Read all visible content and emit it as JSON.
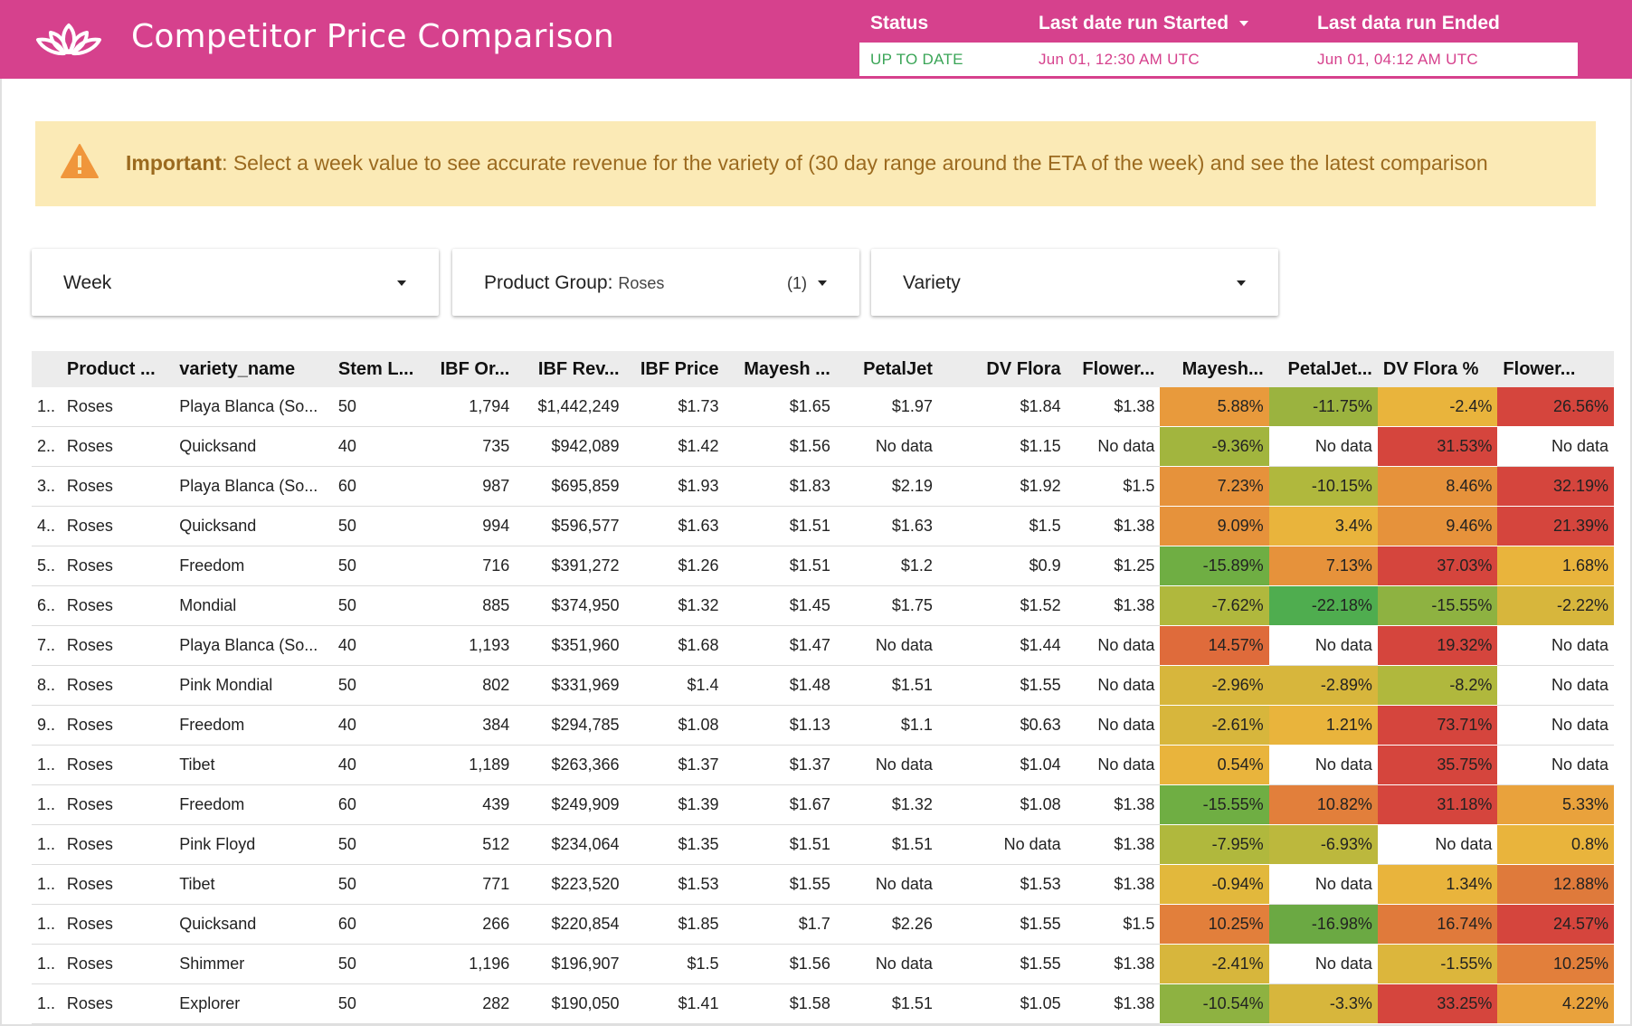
{
  "app": {
    "title": "Competitor Price Comparison"
  },
  "status": {
    "headers": {
      "status": "Status",
      "started": "Last date run Started",
      "ended": "Last data run Ended"
    },
    "status_value": "UP TO DATE",
    "started_value": "Jun 01, 12:30 AM UTC",
    "ended_value": "Jun 01, 04:12 AM UTC",
    "colors": {
      "status": "#3aa557",
      "dates": "#d6418d"
    }
  },
  "alert": {
    "icon": "warning-icon",
    "bold": "Important",
    "text": ": Select a week value to see accurate revenue for the variety of (30 day range around the ETA of the week) and see the latest comparison"
  },
  "filters": {
    "week": {
      "label": "Week"
    },
    "product_group": {
      "label": "Product Group:",
      "value": "Roses",
      "count": "(1)"
    },
    "variety": {
      "label": "Variety"
    }
  },
  "colors": {
    "brand": "#d6418d",
    "alert_bg": "#fbeab6",
    "alert_text": "#9b6a1f",
    "alert_icon": "#f0963b",
    "header_bg": "#ececec"
  },
  "table": {
    "columns": [
      "",
      "Product ...",
      "variety_name",
      "Stem L...",
      "IBF Or...",
      "IBF Rev...",
      "IBF Price",
      "Mayesh ...",
      "PetalJet",
      "DV Flora",
      "Flower...",
      "Mayesh...",
      "PetalJet...",
      "DV Flora %",
      "Flower..."
    ],
    "rows": [
      [
        "1..",
        "Roses",
        "Playa Blanca (So...",
        "50",
        "1,794",
        "$1,442,249",
        "$1.73",
        "$1.65",
        "$1.97",
        "$1.84",
        "$1.38",
        "5.88%",
        "-11.75%",
        "-2.4%",
        "26.56%"
      ],
      [
        "2..",
        "Roses",
        "Quicksand",
        "40",
        "735",
        "$942,089",
        "$1.42",
        "$1.56",
        "No data",
        "$1.15",
        "No data",
        "-9.36%",
        "No data",
        "31.53%",
        "No data"
      ],
      [
        "3..",
        "Roses",
        "Playa Blanca (So...",
        "60",
        "987",
        "$695,859",
        "$1.93",
        "$1.83",
        "$2.19",
        "$1.92",
        "$1.5",
        "7.23%",
        "-10.15%",
        "8.46%",
        "32.19%"
      ],
      [
        "4..",
        "Roses",
        "Quicksand",
        "50",
        "994",
        "$596,577",
        "$1.63",
        "$1.51",
        "$1.63",
        "$1.5",
        "$1.38",
        "9.09%",
        "3.4%",
        "9.46%",
        "21.39%"
      ],
      [
        "5..",
        "Roses",
        "Freedom",
        "50",
        "716",
        "$391,272",
        "$1.26",
        "$1.51",
        "$1.2",
        "$0.9",
        "$1.25",
        "-15.89%",
        "7.13%",
        "37.03%",
        "1.68%"
      ],
      [
        "6..",
        "Roses",
        "Mondial",
        "50",
        "885",
        "$374,950",
        "$1.32",
        "$1.45",
        "$1.75",
        "$1.52",
        "$1.38",
        "-7.62%",
        "-22.18%",
        "-15.55%",
        "-2.22%"
      ],
      [
        "7..",
        "Roses",
        "Playa Blanca (So...",
        "40",
        "1,193",
        "$351,960",
        "$1.68",
        "$1.47",
        "No data",
        "$1.44",
        "No data",
        "14.57%",
        "No data",
        "19.32%",
        "No data"
      ],
      [
        "8..",
        "Roses",
        "Pink Mondial",
        "50",
        "802",
        "$331,969",
        "$1.4",
        "$1.48",
        "$1.51",
        "$1.55",
        "No data",
        "-2.96%",
        "-2.89%",
        "-8.2%",
        "No data"
      ],
      [
        "9..",
        "Roses",
        "Freedom",
        "40",
        "384",
        "$294,785",
        "$1.08",
        "$1.13",
        "$1.1",
        "$0.63",
        "No data",
        "-2.61%",
        "1.21%",
        "73.71%",
        "No data"
      ],
      [
        "1..",
        "Roses",
        "Tibet",
        "40",
        "1,189",
        "$263,366",
        "$1.37",
        "$1.37",
        "No data",
        "$1.04",
        "No data",
        "0.54%",
        "No data",
        "35.75%",
        "No data"
      ],
      [
        "1..",
        "Roses",
        "Freedom",
        "60",
        "439",
        "$249,909",
        "$1.39",
        "$1.67",
        "$1.32",
        "$1.08",
        "$1.38",
        "-15.55%",
        "10.82%",
        "31.18%",
        "5.33%"
      ],
      [
        "1..",
        "Roses",
        "Pink Floyd",
        "50",
        "512",
        "$234,064",
        "$1.35",
        "$1.51",
        "$1.51",
        "No data",
        "$1.38",
        "-7.95%",
        "-6.93%",
        "No data",
        "0.8%"
      ],
      [
        "1..",
        "Roses",
        "Tibet",
        "50",
        "771",
        "$223,520",
        "$1.53",
        "$1.55",
        "No data",
        "$1.53",
        "$1.38",
        "-0.94%",
        "No data",
        "1.34%",
        "12.88%"
      ],
      [
        "1..",
        "Roses",
        "Quicksand",
        "60",
        "266",
        "$220,854",
        "$1.85",
        "$1.7",
        "$2.26",
        "$1.55",
        "$1.5",
        "10.25%",
        "-16.98%",
        "16.74%",
        "24.57%"
      ],
      [
        "1..",
        "Roses",
        "Shimmer",
        "50",
        "1,196",
        "$196,907",
        "$1.5",
        "$1.56",
        "No data",
        "$1.55",
        "$1.38",
        "-2.41%",
        "No data",
        "-1.55%",
        "10.25%"
      ],
      [
        "1..",
        "Roses",
        "Explorer",
        "50",
        "282",
        "$190,050",
        "$1.41",
        "$1.58",
        "$1.51",
        "$1.05",
        "$1.38",
        "-10.54%",
        "-3.3%",
        "33.25%",
        "4.22%"
      ]
    ],
    "cell_colors": [
      [
        "#e89a3c",
        "#9bb33f",
        "#e9b43c",
        "#d5453d"
      ],
      [
        "#a2b53e",
        "#ffffff",
        "#d5453d",
        "#ffffff"
      ],
      [
        "#e6923b",
        "#b0b83d",
        "#e6923b",
        "#d5453d"
      ],
      [
        "#e6923b",
        "#e9b43c",
        "#e6923b",
        "#d5453d"
      ],
      [
        "#6fae43",
        "#e6923b",
        "#d5453d",
        "#e9b43c"
      ],
      [
        "#b0b83d",
        "#4fad4f",
        "#8eb241",
        "#d7b63c"
      ],
      [
        "#df6b3b",
        "#ffffff",
        "#d5453d",
        "#ffffff"
      ],
      [
        "#d7b63c",
        "#d7b63c",
        "#b0b83d",
        "#ffffff"
      ],
      [
        "#d7b63c",
        "#e9b43c",
        "#d5453d",
        "#ffffff"
      ],
      [
        "#e9b43c",
        "#ffffff",
        "#d5453d",
        "#ffffff"
      ],
      [
        "#6fae43",
        "#e27f3b",
        "#d5453d",
        "#e9a23c"
      ],
      [
        "#b0b83d",
        "#bcb83d",
        "#ffffff",
        "#e9b43c"
      ],
      [
        "#e2b83c",
        "#ffffff",
        "#e9b43c",
        "#df7a3b"
      ],
      [
        "#e27f3b",
        "#6ba943",
        "#e07a3b",
        "#d5453d"
      ],
      [
        "#d7b63c",
        "#ffffff",
        "#dcb63c",
        "#e27f3b"
      ],
      [
        "#8eb241",
        "#d7b63c",
        "#d5453d",
        "#e9a23c"
      ]
    ]
  }
}
